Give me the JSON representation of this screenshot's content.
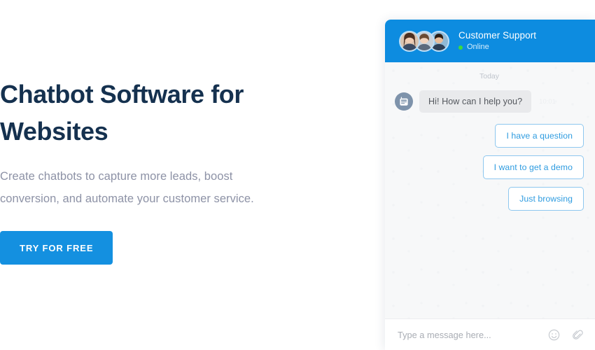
{
  "hero": {
    "title": "Chatbot Software for Websites",
    "subtitle": "Create chatbots to capture more leads, boost conversion, and automate your customer service.",
    "cta_label": "TRY FOR FREE",
    "title_color": "#15314f",
    "subtitle_color": "#8d92a6",
    "cta_color": "#1490e0"
  },
  "chat_widget": {
    "header": {
      "agent_name": "Customer Support",
      "status_label": "Online",
      "status_color": "#3ddb3d",
      "background_color": "#0d8ce0",
      "avatars": [
        {
          "name": "agent-avatar-1"
        },
        {
          "name": "agent-avatar-2"
        },
        {
          "name": "agent-avatar-3"
        }
      ]
    },
    "conversation": {
      "day_divider": "Today",
      "messages": [
        {
          "sender": "bot",
          "text": "Hi! How can I help you?",
          "time": "10:01",
          "avatar_icon": "robot-icon"
        }
      ],
      "quick_replies": [
        {
          "label": "I have a question"
        },
        {
          "label": "I want to get a demo"
        },
        {
          "label": "Just browsing"
        }
      ],
      "chip_border_color": "#8ec7ef",
      "chip_text_color": "#2f9ce0",
      "bubble_color": "#e9eaec"
    },
    "composer": {
      "placeholder": "Type a message here...",
      "value": "",
      "emoji_icon": "smiley-icon",
      "attach_icon": "paperclip-icon"
    }
  }
}
